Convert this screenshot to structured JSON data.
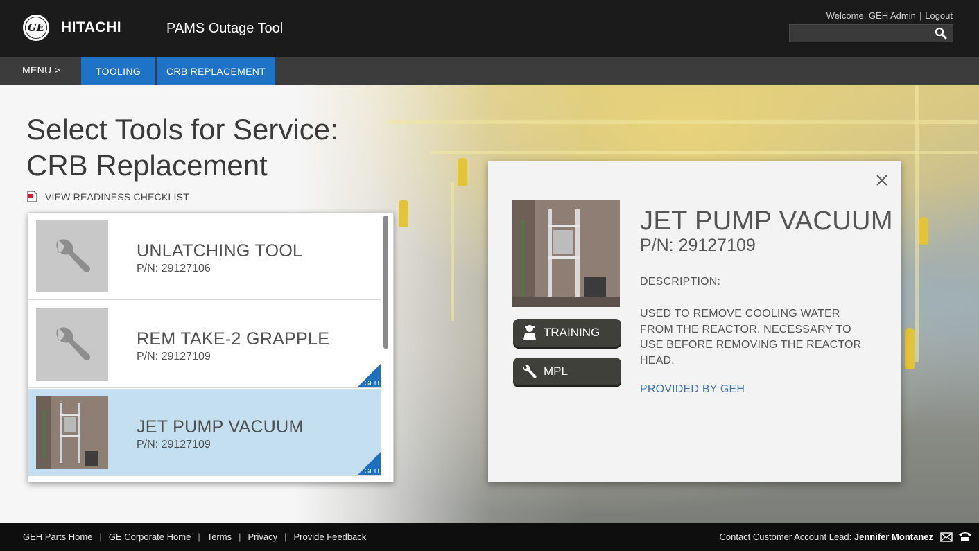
{
  "header": {
    "brand": "HITACHI",
    "ge_logo_text": "GE",
    "app_title": "PAMS Outage Tool",
    "welcome": "Welcome, GEH Admin",
    "logout": "Logout",
    "search_placeholder": ""
  },
  "nav": {
    "menu_label": "MENU >",
    "tabs": [
      {
        "label": "TOOLING"
      },
      {
        "label": "CRB REPLACEMENT"
      }
    ]
  },
  "page": {
    "title_line1": "Select Tools for Service:",
    "title_line2": "CRB Replacement",
    "checklist_link": "VIEW READINESS CHECKLIST"
  },
  "tools": [
    {
      "name": "UNLATCHING TOOL",
      "pn": "P/N: 29127106",
      "geh": false,
      "selected": false,
      "thumb": "wrench-icon"
    },
    {
      "name": "REM TAKE-2 GRAPPLE",
      "pn": "P/N: 29127109",
      "geh": true,
      "selected": false,
      "thumb": "wrench-icon"
    },
    {
      "name": "JET PUMP VACUUM",
      "pn": "P/N: 29127109",
      "geh": true,
      "selected": true,
      "thumb": "tool-photo"
    }
  ],
  "badge_label": "GEH",
  "detail": {
    "title": "JET PUMP VACUUM",
    "pn": "P/N: 29127109",
    "description_label": "DESCRIPTION:",
    "description": "USED TO REMOVE COOLING WATER FROM THE REACTOR. NECESSARY TO USE BEFORE REMOVING THE REACTOR HEAD.",
    "provided_by": "PROVIDED BY GEH",
    "training_label": "TRAINING",
    "mpl_label": "MPL"
  },
  "footer": {
    "links": [
      "GEH Parts Home",
      "GE Corporate Home",
      "Terms",
      "Privacy",
      "Provide Feedback"
    ],
    "contact_label": "Contact Customer Account Lead:",
    "contact_name": "Jennifer Montanez"
  },
  "colors": {
    "header_bg": "#1b1b1b",
    "nav_bg": "#3c3c3c",
    "tab_active": "#1f73c6",
    "selected_row": "#c4dff0",
    "link_blue": "#3f74b3",
    "button_dark": "#40403b"
  }
}
